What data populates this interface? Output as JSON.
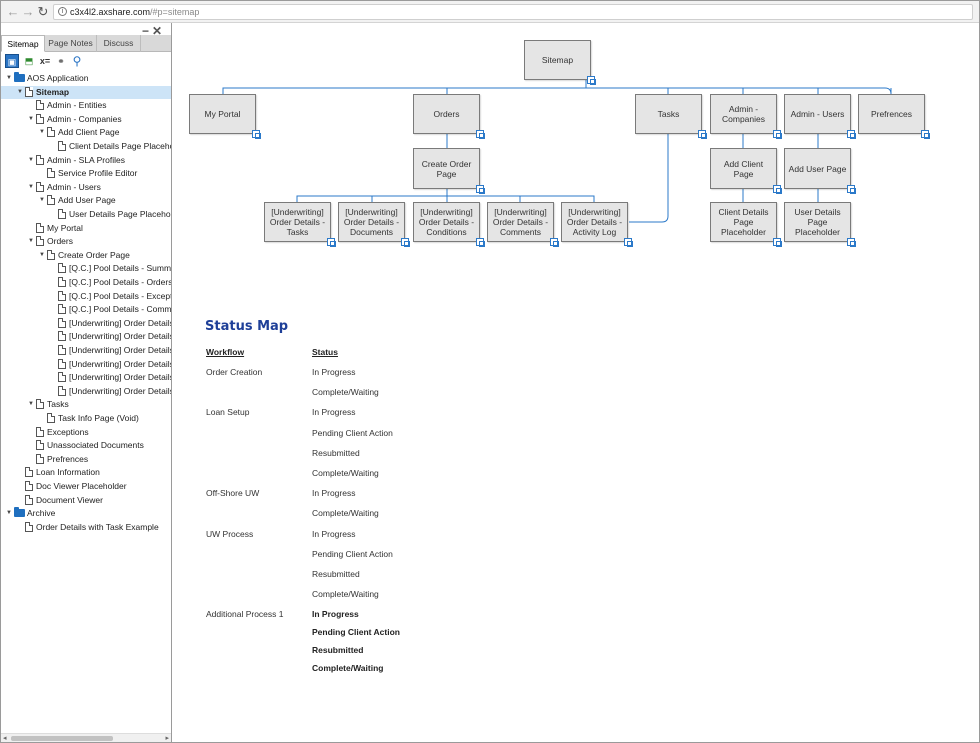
{
  "browser": {
    "url_host": "c3x4l2.axshare.com",
    "url_path": "/#p=sitemap"
  },
  "leftpane": {
    "tabs": [
      "Sitemap",
      "Page Notes",
      "Discuss"
    ],
    "tree": [
      {
        "label": "AOS Application",
        "level": 0,
        "type": "folder",
        "expanded": true
      },
      {
        "label": "Sitemap",
        "level": 1,
        "type": "page",
        "expanded": true,
        "selected": true
      },
      {
        "label": "Admin - Entities",
        "level": 2,
        "type": "page"
      },
      {
        "label": "Admin - Companies",
        "level": 2,
        "type": "page",
        "expanded": true
      },
      {
        "label": "Add Client Page",
        "level": 3,
        "type": "page",
        "expanded": true
      },
      {
        "label": "Client Details Page Placeho",
        "level": 4,
        "type": "page"
      },
      {
        "label": "Admin - SLA Profiles",
        "level": 2,
        "type": "page",
        "expanded": true
      },
      {
        "label": "Service Profile Editor",
        "level": 3,
        "type": "page"
      },
      {
        "label": "Admin - Users",
        "level": 2,
        "type": "page",
        "expanded": true
      },
      {
        "label": "Add User Page",
        "level": 3,
        "type": "page",
        "expanded": true
      },
      {
        "label": "User Details Page Placehol",
        "level": 4,
        "type": "page"
      },
      {
        "label": "My Portal",
        "level": 2,
        "type": "page"
      },
      {
        "label": "Orders",
        "level": 2,
        "type": "page",
        "expanded": true
      },
      {
        "label": "Create Order Page",
        "level": 3,
        "type": "page",
        "expanded": true
      },
      {
        "label": "[Q.C.] Pool Details - Summa",
        "level": 4,
        "type": "page"
      },
      {
        "label": "[Q.C.] Pool Details - Orders",
        "level": 4,
        "type": "page"
      },
      {
        "label": "[Q.C.] Pool Details - Excepti",
        "level": 4,
        "type": "page"
      },
      {
        "label": "[Q.C.] Pool Details - Comme",
        "level": 4,
        "type": "page"
      },
      {
        "label": "[Underwriting] Order Details",
        "level": 4,
        "type": "page"
      },
      {
        "label": "[Underwriting] Order Details",
        "level": 4,
        "type": "page"
      },
      {
        "label": "[Underwriting] Order Details",
        "level": 4,
        "type": "page"
      },
      {
        "label": "[Underwriting] Order Details",
        "level": 4,
        "type": "page"
      },
      {
        "label": "[Underwriting] Order Details",
        "level": 4,
        "type": "page"
      },
      {
        "label": "[Underwriting] Order Details",
        "level": 4,
        "type": "page"
      },
      {
        "label": "Tasks",
        "level": 2,
        "type": "page",
        "expanded": true
      },
      {
        "label": "Task Info Page (Void)",
        "level": 3,
        "type": "page"
      },
      {
        "label": "Exceptions",
        "level": 2,
        "type": "page"
      },
      {
        "label": "Unassociated Documents",
        "level": 2,
        "type": "page"
      },
      {
        "label": "Prefrences",
        "level": 2,
        "type": "page"
      },
      {
        "label": "Loan Information",
        "level": 1,
        "type": "page"
      },
      {
        "label": "Doc Viewer Placeholder",
        "level": 1,
        "type": "page"
      },
      {
        "label": "Document Viewer",
        "level": 1,
        "type": "page"
      },
      {
        "label": "Archive",
        "level": 0,
        "type": "folder",
        "expanded": true
      },
      {
        "label": "Order Details with Task Example",
        "level": 1,
        "type": "page"
      }
    ]
  },
  "sitemap": {
    "root": "Sitemap",
    "level1": [
      "My Portal",
      "Orders",
      "Tasks",
      "Admin - Companies",
      "Admin - Users",
      "Prefrences"
    ],
    "create_order": "Create Order Page",
    "underwriting": [
      "[Underwriting] Order Details - Tasks",
      "[Underwriting] Order Details - Documents",
      "[Underwriting] Order Details - Conditions",
      "[Underwriting] Order Details - Comments",
      "[Underwriting] Order Details - Activity Log"
    ],
    "add_client": "Add Client Page",
    "add_user": "Add User Page",
    "client_details": "Client Details Page Placeholder",
    "user_details": "User Details Page Placeholder"
  },
  "status_map": {
    "title": "Status Map",
    "col_workflow": "Workflow",
    "col_status": "Status",
    "rows": [
      {
        "workflow": "Order Creation",
        "status": "In Progress",
        "bold": false
      },
      {
        "workflow": "",
        "status": "Complete/Waiting",
        "bold": false
      },
      {
        "workflow": "Loan Setup",
        "status": "In Progress",
        "bold": false
      },
      {
        "workflow": "",
        "status": "Pending Client Action",
        "bold": false
      },
      {
        "workflow": "",
        "status": "Resubmitted",
        "bold": false
      },
      {
        "workflow": "",
        "status": "Complete/Waiting",
        "bold": false
      },
      {
        "workflow": "Off-Shore UW",
        "status": "In Progress",
        "bold": false
      },
      {
        "workflow": "",
        "status": "Complete/Waiting",
        "bold": false
      },
      {
        "workflow": "UW Process",
        "status": "In Progress",
        "bold": false
      },
      {
        "workflow": "",
        "status": "Pending Client Action",
        "bold": false
      },
      {
        "workflow": "",
        "status": "Resubmitted",
        "bold": false
      },
      {
        "workflow": "",
        "status": "Complete/Waiting",
        "bold": false
      },
      {
        "workflow": "Additional Process 1",
        "status": "In Progress",
        "bold": true
      },
      {
        "workflow": "",
        "status": "Pending Client Action",
        "bold": true
      },
      {
        "workflow": "",
        "status": "Resubmitted",
        "bold": true
      },
      {
        "workflow": "",
        "status": "Complete/Waiting",
        "bold": true
      }
    ]
  },
  "colors": {
    "accent": "#1e3f98",
    "connector": "#2b79c9",
    "box_fill": "#e5e5e5",
    "selected": "#cde4f7"
  }
}
